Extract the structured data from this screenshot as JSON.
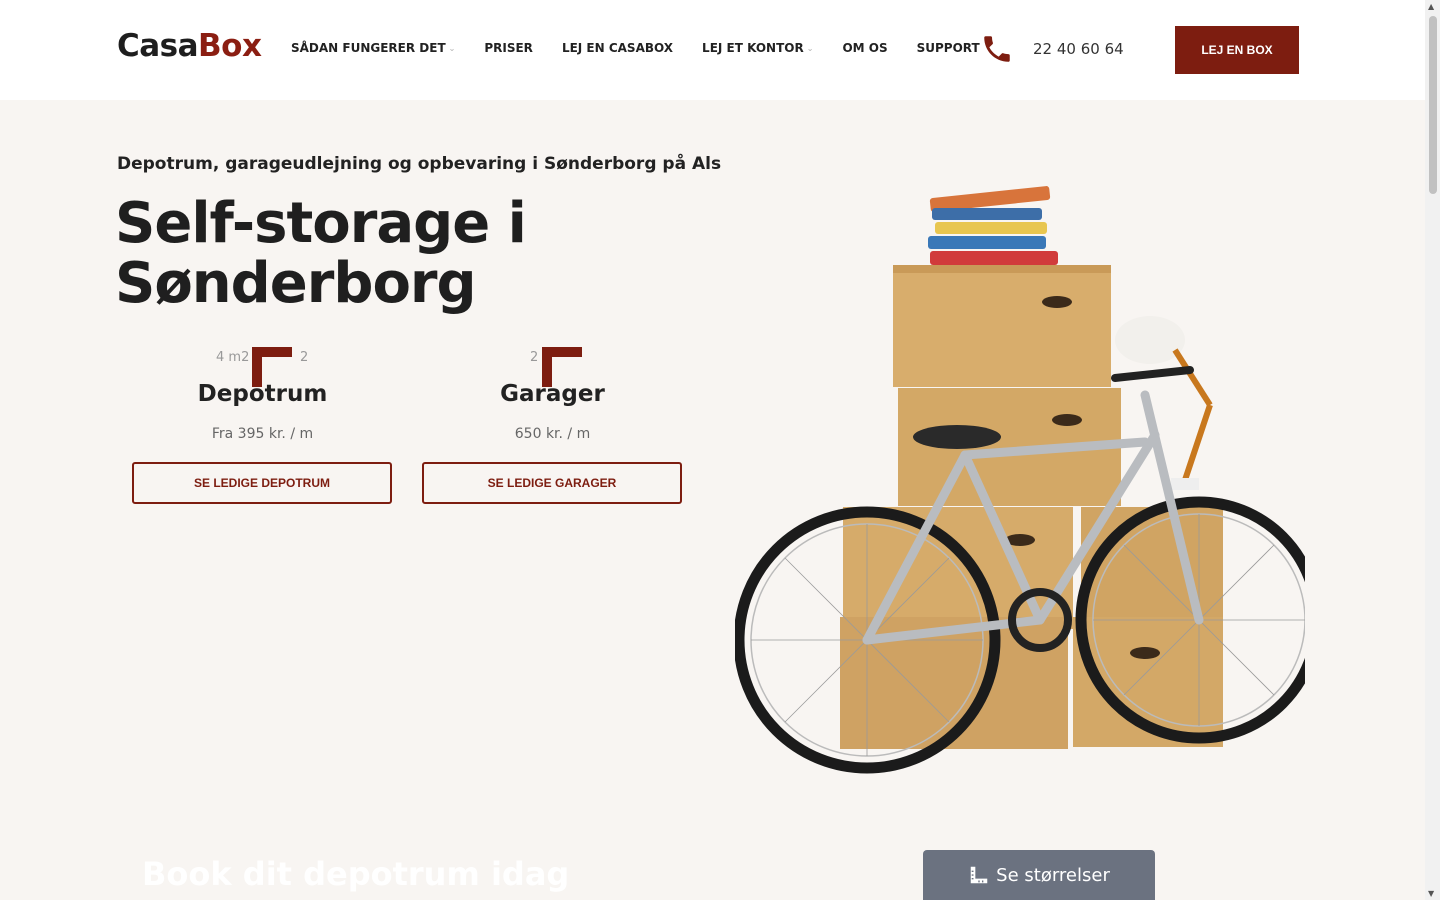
{
  "header": {
    "logo_part1": "Casa",
    "logo_part2": "Box",
    "nav": [
      {
        "label": "SÅDAN FUNGERER DET",
        "has_dropdown": true
      },
      {
        "label": "PRISER",
        "has_dropdown": false
      },
      {
        "label": "LEJ EN CASABOX",
        "has_dropdown": false
      },
      {
        "label": "LEJ ET KONTOR",
        "has_dropdown": true
      },
      {
        "label": "OM OS",
        "has_dropdown": false
      },
      {
        "label": "SUPPORT",
        "has_dropdown": false
      }
    ],
    "phone_icon": "phone-icon",
    "phone": "22 40 60 64",
    "cta": "LEJ EN BOX"
  },
  "hero": {
    "subtitle": "Depotrum, garageudlejning og opbevaring i Sønderborg på Als",
    "title_line1": "Self-storage i",
    "title_line2": "Sønderborg",
    "cards": [
      {
        "size_left": "4 m2",
        "size_right": "2",
        "title": "Depotrum",
        "price": "Fra 395 kr. / m",
        "button": "SE LEDIGE DEPOTRUM"
      },
      {
        "size_left": "2",
        "size_right": "",
        "title": "Garager",
        "price": "650 kr. / m",
        "button": "SE LEDIGE GARAGER"
      }
    ]
  },
  "bottom": {
    "heading": "Book dit depotrum idag",
    "sizes_button": "Se størrelser",
    "sizes_icon": "ruler-icon"
  },
  "colors": {
    "brand": "#7d1d10",
    "hero_bg": "#f8f5f2",
    "sizes_button_bg": "#6b7280"
  }
}
